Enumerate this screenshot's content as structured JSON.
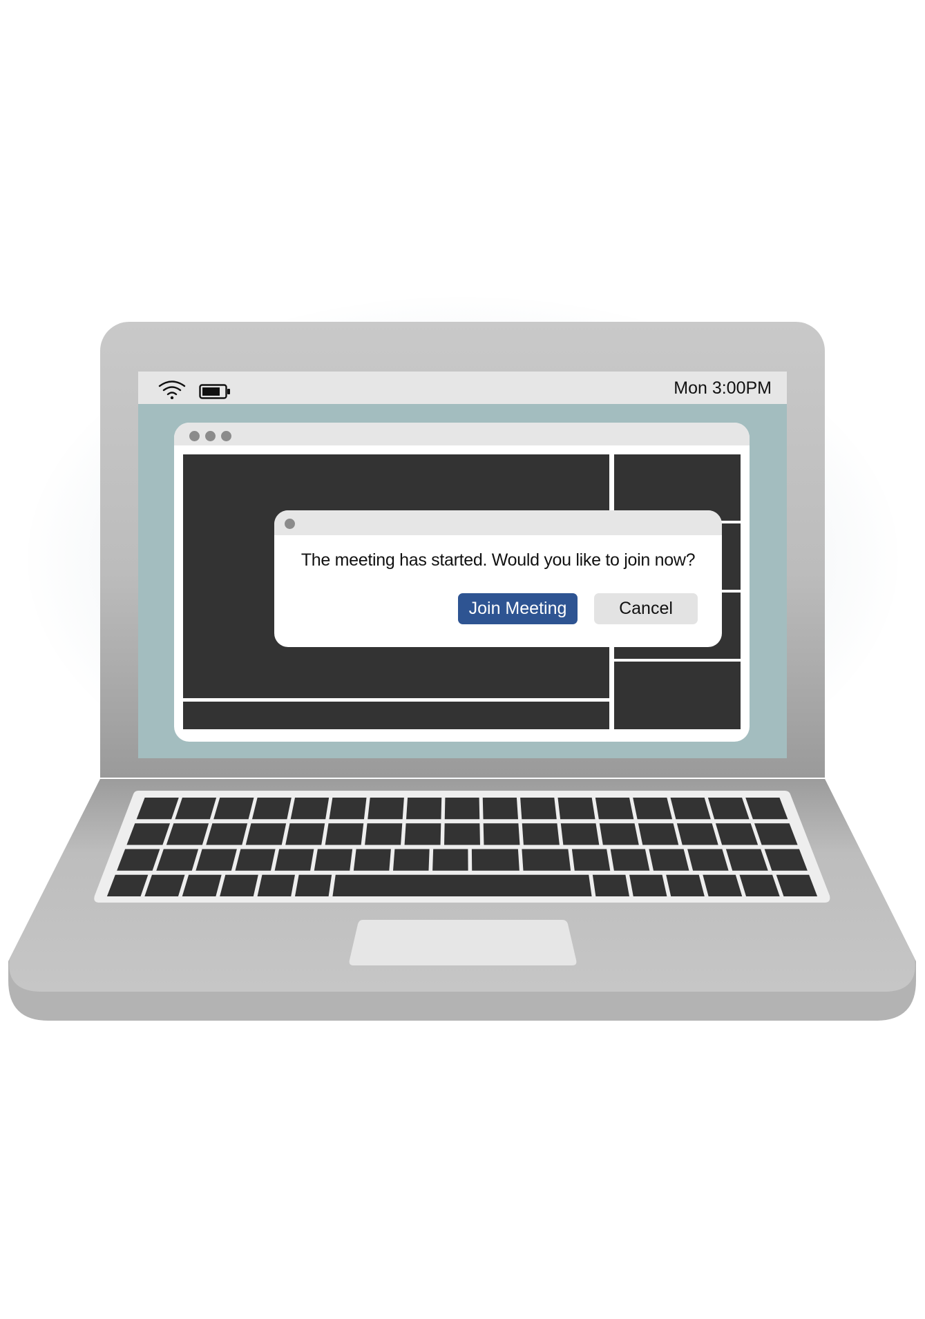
{
  "system": {
    "clock": "Mon 3:00PM",
    "wifi_icon": "wifi-icon",
    "battery_icon": "battery-icon"
  },
  "app_window": {
    "window_controls": [
      "window-dot",
      "window-dot",
      "window-dot"
    ]
  },
  "dialog": {
    "message": "The meeting has started. Would you like to join now?",
    "primary_button": "Join Meeting",
    "secondary_button": "Cancel"
  },
  "colors": {
    "desktop": "#a3bdbf",
    "primary_button": "#2e5492",
    "video_tiles": "#333333",
    "laptop_body": "#c4c4c4"
  }
}
